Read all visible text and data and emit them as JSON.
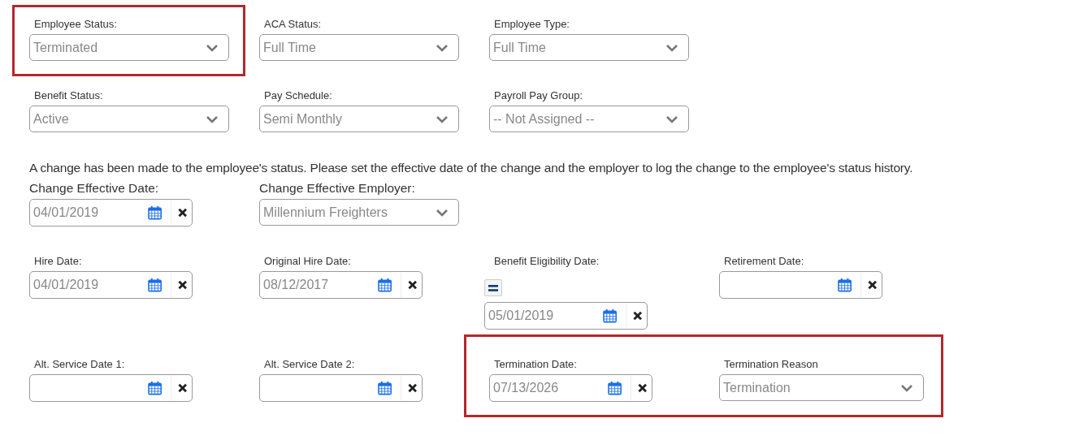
{
  "rows": [
    {
      "cells": [
        {
          "kind": "group",
          "highlighted": true,
          "fields": [
            {
              "kind": "select",
              "label": "Employee Status:",
              "value": "Terminated"
            }
          ]
        },
        {
          "kind": "select",
          "label": "ACA Status:",
          "value": "Full Time"
        },
        {
          "kind": "select",
          "label": "Employee Type:",
          "value": "Full Time"
        }
      ]
    },
    {
      "cells": [
        {
          "kind": "select",
          "label": "Benefit Status:",
          "value": "Active"
        },
        {
          "kind": "select",
          "label": "Pay Schedule:",
          "value": "Semi Monthly"
        },
        {
          "kind": "select",
          "label": "Payroll Pay Group:",
          "value": "-- Not Assigned --"
        }
      ]
    },
    {
      "message": "A change has been made to the employee's status. Please set the effective date of the change and the employer to log the change to the employee's status history."
    },
    {
      "large": true,
      "cells": [
        {
          "kind": "date",
          "label": "Change Effective Date:",
          "value": "04/01/2019"
        },
        {
          "kind": "select",
          "label": "Change Effective Employer:",
          "value": "Millennium Freighters"
        }
      ]
    },
    {
      "cells": [
        {
          "kind": "date",
          "label": "Hire Date:",
          "value": "04/01/2019"
        },
        {
          "kind": "date",
          "label": "Original Hire Date:",
          "value": "08/12/2017"
        },
        {
          "kind": "date",
          "label": "Benefit Eligibility Date:",
          "value": "05/01/2019",
          "equals_button": true
        },
        {
          "kind": "date",
          "label": "Retirement Date:"
        }
      ]
    },
    {
      "cells": [
        {
          "kind": "date",
          "label": "Alt. Service Date 1:"
        },
        {
          "kind": "date",
          "label": "Alt. Service Date 2:"
        },
        {
          "kind": "group",
          "highlighted": true,
          "fields": [
            {
              "kind": "date",
              "label": "Termination Date:",
              "value": "07/13/2026"
            },
            {
              "kind": "select",
              "label": "Termination Reason",
              "value": "Termination",
              "narrow": true
            }
          ]
        }
      ]
    }
  ]
}
